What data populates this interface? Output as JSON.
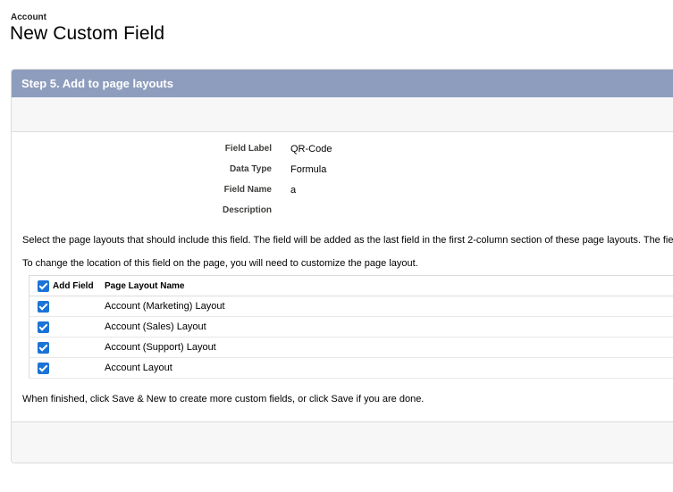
{
  "header": {
    "breadcrumb": "Account",
    "title": "New Custom Field"
  },
  "step": {
    "title": "Step 5. Add to page layouts"
  },
  "details": {
    "field_label_label": "Field Label",
    "field_label_value": "QR-Code",
    "data_type_label": "Data Type",
    "data_type_value": "Formula",
    "field_name_label": "Field Name",
    "field_name_value": "a",
    "description_label": "Description",
    "description_value": ""
  },
  "instructions": {
    "line1": "Select the page layouts that should include this field. The field will be added as the last field in the first 2-column section of these page layouts. The field",
    "line2": "To change the location of this field on the page, you will need to customize the page layout.",
    "footer": "When finished, click Save & New to create more custom fields, or click Save if you are done."
  },
  "table": {
    "col_add": "Add Field",
    "col_name": "Page Layout Name",
    "rows": [
      {
        "name": "Account (Marketing) Layout",
        "checked": true
      },
      {
        "name": "Account (Sales) Layout",
        "checked": true
      },
      {
        "name": "Account (Support) Layout",
        "checked": true
      },
      {
        "name": "Account Layout",
        "checked": true
      }
    ]
  },
  "colors": {
    "header_bg": "#8e9dbd",
    "checkbox": "#1b73d6",
    "bar_bg": "#f7f7f7"
  }
}
